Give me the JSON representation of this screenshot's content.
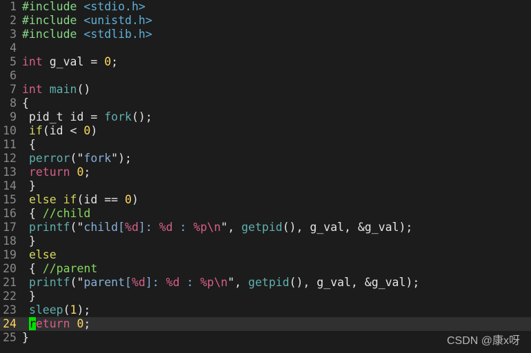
{
  "editor": {
    "lines": [
      {
        "n": "1",
        "tokens": [
          {
            "t": "#include ",
            "c": "pre"
          },
          {
            "t": "<stdio.h>",
            "c": "inc"
          }
        ]
      },
      {
        "n": "2",
        "tokens": [
          {
            "t": "#include ",
            "c": "pre"
          },
          {
            "t": "<unistd.h>",
            "c": "inc"
          }
        ]
      },
      {
        "n": "3",
        "tokens": [
          {
            "t": "#include ",
            "c": "pre"
          },
          {
            "t": "<stdlib.h>",
            "c": "inc"
          }
        ]
      },
      {
        "n": "4",
        "tokens": []
      },
      {
        "n": "5",
        "tokens": [
          {
            "t": "int",
            "c": "type"
          },
          {
            "t": " g_val = ",
            "c": "plain"
          },
          {
            "t": "0",
            "c": "num"
          },
          {
            "t": ";",
            "c": "plain"
          }
        ]
      },
      {
        "n": "6",
        "tokens": []
      },
      {
        "n": "7",
        "tokens": [
          {
            "t": "int",
            "c": "type"
          },
          {
            "t": " ",
            "c": "plain"
          },
          {
            "t": "main",
            "c": "fn"
          },
          {
            "t": "()",
            "c": "plain"
          }
        ]
      },
      {
        "n": "8",
        "tokens": [
          {
            "t": "{",
            "c": "plain"
          }
        ]
      },
      {
        "n": "9",
        "tokens": [
          {
            "t": " pid_t id = ",
            "c": "plain"
          },
          {
            "t": "fork",
            "c": "fn"
          },
          {
            "t": "();",
            "c": "plain"
          }
        ]
      },
      {
        "n": "10",
        "tokens": [
          {
            "t": " ",
            "c": "plain"
          },
          {
            "t": "if",
            "c": "kw"
          },
          {
            "t": "(id < ",
            "c": "plain"
          },
          {
            "t": "0",
            "c": "num"
          },
          {
            "t": ")",
            "c": "plain"
          }
        ]
      },
      {
        "n": "11",
        "tokens": [
          {
            "t": " {",
            "c": "plain"
          }
        ]
      },
      {
        "n": "12",
        "tokens": [
          {
            "t": " ",
            "c": "plain"
          },
          {
            "t": "perror",
            "c": "fn"
          },
          {
            "t": "(\"",
            "c": "plain"
          },
          {
            "t": "fork",
            "c": "str"
          },
          {
            "t": "\");",
            "c": "plain"
          }
        ]
      },
      {
        "n": "13",
        "tokens": [
          {
            "t": " ",
            "c": "plain"
          },
          {
            "t": "return",
            "c": "type"
          },
          {
            "t": " ",
            "c": "plain"
          },
          {
            "t": "0",
            "c": "num"
          },
          {
            "t": ";",
            "c": "plain"
          }
        ]
      },
      {
        "n": "14",
        "tokens": [
          {
            "t": " }",
            "c": "plain"
          }
        ]
      },
      {
        "n": "15",
        "tokens": [
          {
            "t": " ",
            "c": "plain"
          },
          {
            "t": "else",
            "c": "kw"
          },
          {
            "t": " ",
            "c": "plain"
          },
          {
            "t": "if",
            "c": "kw"
          },
          {
            "t": "(id == ",
            "c": "plain"
          },
          {
            "t": "0",
            "c": "num"
          },
          {
            "t": ")",
            "c": "plain"
          }
        ]
      },
      {
        "n": "16",
        "tokens": [
          {
            "t": " { ",
            "c": "plain"
          },
          {
            "t": "//child",
            "c": "comment"
          }
        ]
      },
      {
        "n": "17",
        "tokens": [
          {
            "t": " ",
            "c": "plain"
          },
          {
            "t": "printf",
            "c": "fn"
          },
          {
            "t": "(\"",
            "c": "plain"
          },
          {
            "t": "child[",
            "c": "str"
          },
          {
            "t": "%d",
            "c": "fmt"
          },
          {
            "t": "]: ",
            "c": "str"
          },
          {
            "t": "%d",
            "c": "fmt"
          },
          {
            "t": " : ",
            "c": "str"
          },
          {
            "t": "%p\\n",
            "c": "fmt"
          },
          {
            "t": "\", ",
            "c": "plain"
          },
          {
            "t": "getpid",
            "c": "fn"
          },
          {
            "t": "(), g_val, &g_val);",
            "c": "plain"
          }
        ]
      },
      {
        "n": "18",
        "tokens": [
          {
            "t": " }",
            "c": "plain"
          }
        ]
      },
      {
        "n": "19",
        "tokens": [
          {
            "t": " ",
            "c": "plain"
          },
          {
            "t": "else",
            "c": "kw"
          }
        ]
      },
      {
        "n": "20",
        "tokens": [
          {
            "t": " { ",
            "c": "plain"
          },
          {
            "t": "//parent",
            "c": "comment"
          }
        ]
      },
      {
        "n": "21",
        "tokens": [
          {
            "t": " ",
            "c": "plain"
          },
          {
            "t": "printf",
            "c": "fn"
          },
          {
            "t": "(\"",
            "c": "plain"
          },
          {
            "t": "parent[",
            "c": "str"
          },
          {
            "t": "%d",
            "c": "fmt"
          },
          {
            "t": "]: ",
            "c": "str"
          },
          {
            "t": "%d",
            "c": "fmt"
          },
          {
            "t": " : ",
            "c": "str"
          },
          {
            "t": "%p\\n",
            "c": "fmt"
          },
          {
            "t": "\", ",
            "c": "plain"
          },
          {
            "t": "getpid",
            "c": "fn"
          },
          {
            "t": "(), g_val, &g_val);",
            "c": "plain"
          }
        ]
      },
      {
        "n": "22",
        "tokens": [
          {
            "t": " }",
            "c": "plain"
          }
        ]
      },
      {
        "n": "23",
        "tokens": [
          {
            "t": " ",
            "c": "plain"
          },
          {
            "t": "sleep",
            "c": "fn"
          },
          {
            "t": "(",
            "c": "plain"
          },
          {
            "t": "1",
            "c": "num"
          },
          {
            "t": ");",
            "c": "plain"
          }
        ]
      },
      {
        "n": "24",
        "current": true,
        "tokens": [
          {
            "t": " ",
            "c": "plain"
          },
          {
            "t": "r",
            "c": "cursor"
          },
          {
            "t": "eturn",
            "c": "type"
          },
          {
            "t": " ",
            "c": "plain"
          },
          {
            "t": "0",
            "c": "num"
          },
          {
            "t": ";",
            "c": "plain"
          }
        ]
      },
      {
        "n": "25",
        "tokens": [
          {
            "t": "}",
            "c": "plain"
          }
        ]
      }
    ]
  },
  "watermark": "CSDN @康x呀",
  "colors": {
    "background": "#1c1c1c",
    "current_line": "#303030",
    "line_number": "#8a8a8a",
    "cursor": "#00e000",
    "preprocessor": "#87d787",
    "include_path": "#5fafd7",
    "type": "#d75f87",
    "keyword": "#d7d75f",
    "function": "#5fafaf",
    "number": "#ffd75f",
    "string": "#87afd7",
    "comment": "#87d75f"
  }
}
